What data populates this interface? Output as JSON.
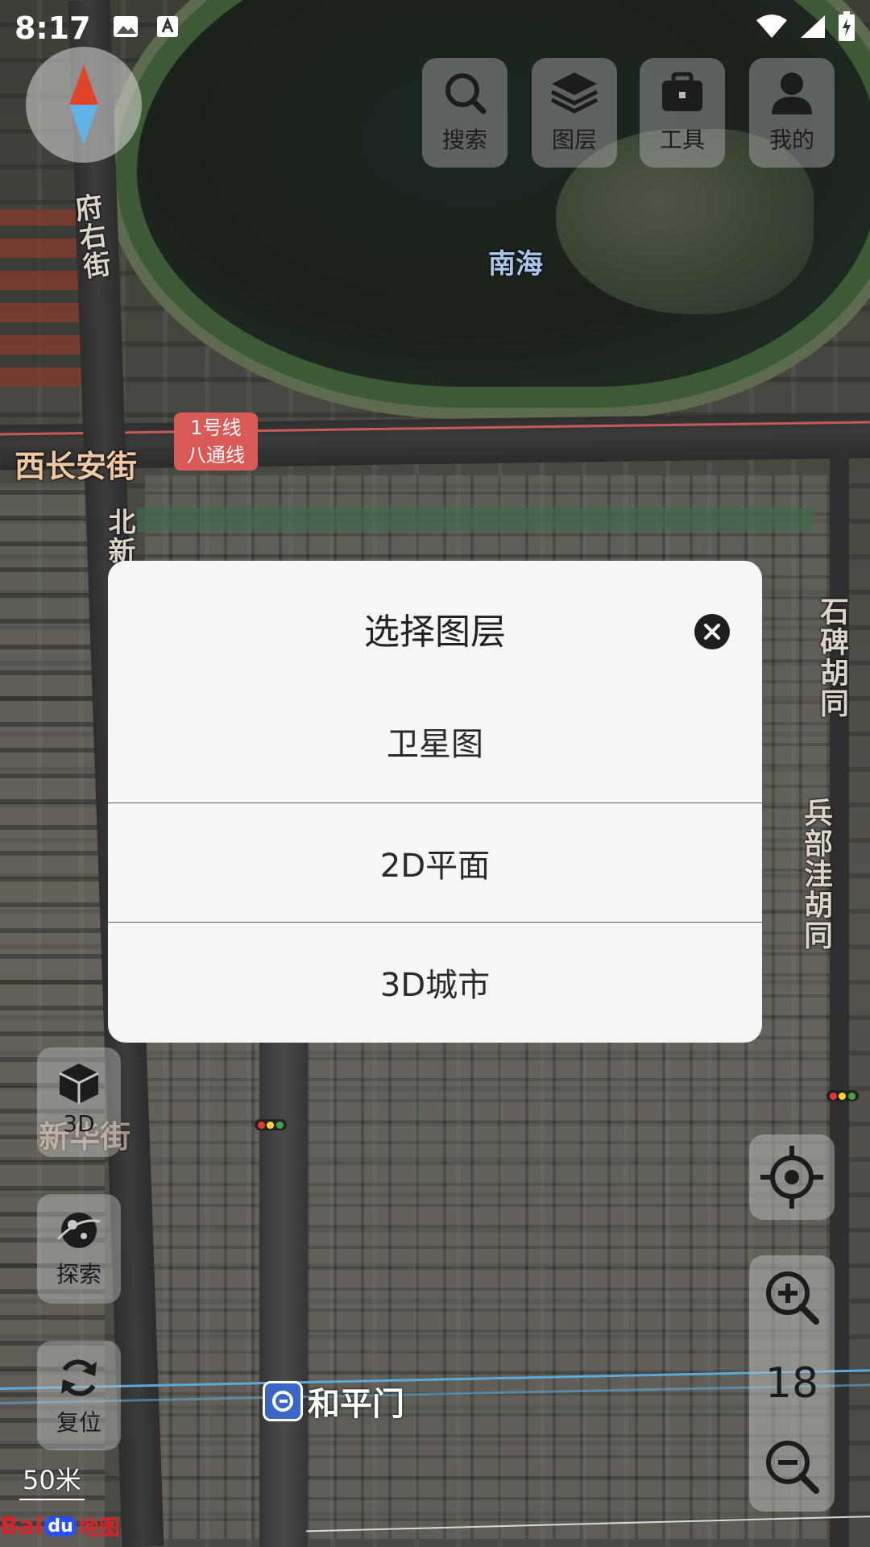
{
  "status_bar": {
    "time": "8:17",
    "left_icons": [
      "image-icon",
      "text-a-icon"
    ],
    "right_icons": [
      "wifi-icon",
      "signal-icon",
      "battery-charging-icon"
    ]
  },
  "toolbar": {
    "search_label": "搜索",
    "layers_label": "图层",
    "tools_label": "工具",
    "mine_label": "我的"
  },
  "map_labels": {
    "fuyoujie": "府右街",
    "nanhai": "南海",
    "xichanganjie": "西长安街",
    "metro_line_1": "1号线",
    "metro_line_2": "八通线",
    "beixin": "北新",
    "shibeihutong": "石碑胡同",
    "bingbuwahutong": "兵部洼胡同",
    "xinhuajie": "新华街",
    "station": "和平门"
  },
  "side_controls": {
    "view3d_label": "3D",
    "explore_label": "探索",
    "reset_label": "复位"
  },
  "zoom": {
    "level": "18"
  },
  "scale": "50米",
  "logo": {
    "bai": "Bai",
    "du": "du",
    "map": "地图"
  },
  "dialog": {
    "title": "选择图层",
    "options": [
      {
        "label": "卫星图"
      },
      {
        "label": "2D平面"
      },
      {
        "label": "3D城市"
      }
    ]
  },
  "colors": {
    "compass_north": "#e0452b",
    "compass_south": "#5fb3e6",
    "dialog_bg": "#f6f6f8",
    "metro_badge": "#d95a57",
    "station_icon": "#3a66c8"
  }
}
